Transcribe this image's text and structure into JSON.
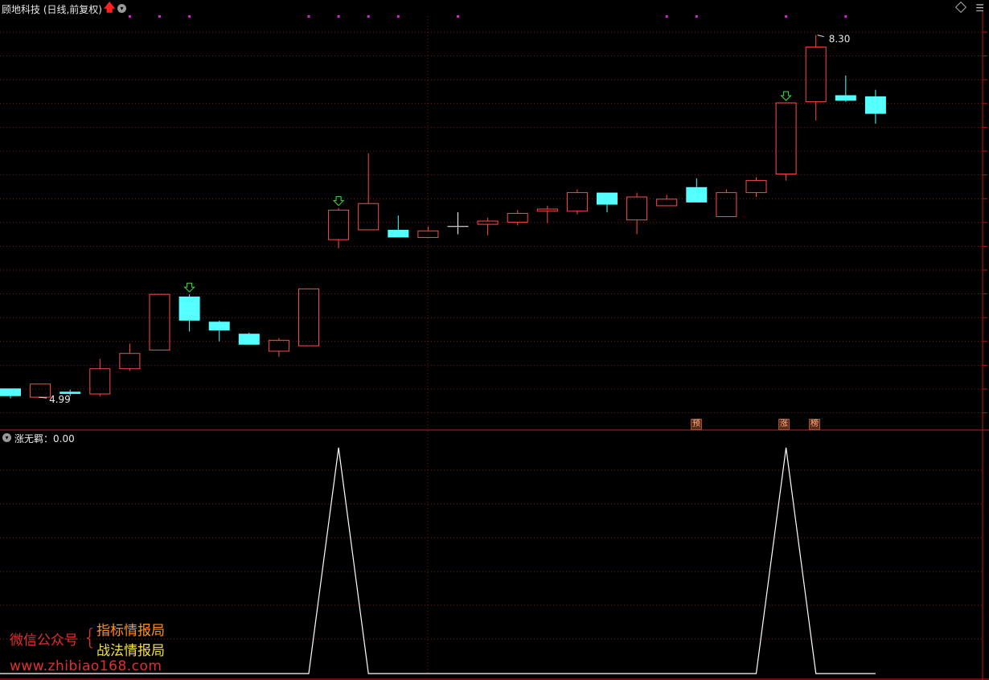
{
  "header": {
    "stock_title": "顾地科技 (日线,前复权)",
    "up_arrow_icon": "red-up-arrow-icon",
    "dropdown_icon": "chevron-down-icon"
  },
  "price_labels": {
    "high": "8.30",
    "low": "4.99"
  },
  "indicator": {
    "title": "涨无羁：0.00"
  },
  "event_tags": [
    "预",
    "涨",
    "榜"
  ],
  "watermark": {
    "line1": "微信公众号",
    "brace": "{",
    "name1": "指标情报局",
    "name2": "战法情报局",
    "url": "www.zhibiao168.com"
  },
  "colors": {
    "up_candle": "#ff4b4b",
    "down_candle": "#54ffff",
    "signal_arrow": "#3ce03c",
    "grid": "#7a1a1a",
    "indicator_line": "#ffffff",
    "marker_dot": "#e020e0"
  },
  "chart_data": {
    "type": "candlestick",
    "candles": [
      {
        "open": 5.07,
        "close": 5.0,
        "high": 5.07,
        "low": 4.98
      },
      {
        "open": 4.99,
        "close": 5.11,
        "high": 5.11,
        "low": 4.99
      },
      {
        "open": 5.04,
        "close": 5.02,
        "high": 5.06,
        "low": 5.0
      },
      {
        "open": 5.02,
        "close": 5.25,
        "high": 5.34,
        "low": 5.0
      },
      {
        "open": 5.25,
        "close": 5.39,
        "high": 5.48,
        "low": 5.23
      },
      {
        "open": 5.42,
        "close": 5.93,
        "high": 5.93,
        "low": 5.42
      },
      {
        "open": 5.91,
        "close": 5.69,
        "high": 5.93,
        "low": 5.59
      },
      {
        "open": 5.68,
        "close": 5.6,
        "high": 5.69,
        "low": 5.5
      },
      {
        "open": 5.57,
        "close": 5.47,
        "high": 5.58,
        "low": 5.47
      },
      {
        "open": 5.41,
        "close": 5.51,
        "high": 5.53,
        "low": 5.36
      },
      {
        "open": 5.46,
        "close": 5.98,
        "high": 5.98,
        "low": 5.46
      },
      {
        "open": 6.43,
        "close": 6.7,
        "high": 6.72,
        "low": 6.35
      },
      {
        "open": 6.52,
        "close": 6.76,
        "high": 7.22,
        "low": 6.52
      },
      {
        "open": 6.52,
        "close": 6.45,
        "high": 6.65,
        "low": 6.45
      },
      {
        "open": 6.45,
        "close": 6.51,
        "high": 6.55,
        "low": 6.45
      },
      {
        "open": 6.55,
        "close": 6.55,
        "high": 6.68,
        "low": 6.48
      },
      {
        "open": 6.57,
        "close": 6.6,
        "high": 6.63,
        "low": 6.47
      },
      {
        "open": 6.59,
        "close": 6.67,
        "high": 6.7,
        "low": 6.56
      },
      {
        "open": 6.69,
        "close": 6.71,
        "high": 6.74,
        "low": 6.58
      },
      {
        "open": 6.69,
        "close": 6.86,
        "high": 6.89,
        "low": 6.66
      },
      {
        "open": 6.86,
        "close": 6.75,
        "high": 6.86,
        "low": 6.68
      },
      {
        "open": 6.61,
        "close": 6.82,
        "high": 6.86,
        "low": 6.48
      },
      {
        "open": 6.74,
        "close": 6.8,
        "high": 6.84,
        "low": 6.74
      },
      {
        "open": 6.91,
        "close": 6.77,
        "high": 6.99,
        "low": 6.77
      },
      {
        "open": 6.64,
        "close": 6.86,
        "high": 6.89,
        "low": 6.64
      },
      {
        "open": 6.86,
        "close": 6.97,
        "high": 7.0,
        "low": 6.82
      },
      {
        "open": 7.03,
        "close": 7.68,
        "high": 7.68,
        "low": 6.97
      },
      {
        "open": 7.69,
        "close": 8.19,
        "high": 8.3,
        "low": 7.52
      },
      {
        "open": 7.75,
        "close": 7.7,
        "high": 7.93,
        "low": 7.69
      },
      {
        "open": 7.74,
        "close": 7.58,
        "high": 7.8,
        "low": 7.49
      }
    ],
    "signal_arrows_at": [
      6,
      11,
      26
    ],
    "top_markers_at": [
      4,
      5,
      6,
      10,
      11,
      12,
      13,
      15,
      22,
      23,
      26,
      28
    ],
    "indicator": {
      "name": "涨无羁",
      "values": [
        0,
        0,
        0,
        0,
        0,
        0,
        0,
        0,
        0,
        0,
        0,
        1,
        0,
        0,
        0,
        0,
        0,
        0,
        0,
        0,
        0,
        0,
        0,
        0,
        0,
        0,
        1,
        0,
        0,
        0
      ]
    }
  }
}
